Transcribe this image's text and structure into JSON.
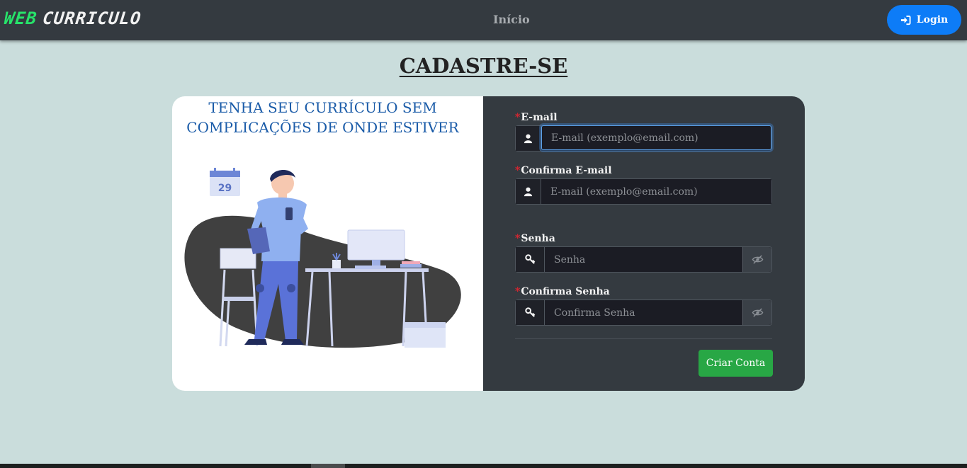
{
  "navbar": {
    "brand_part1": "WEB",
    "brand_part2": "CURRICULO",
    "home_link": "Início",
    "login_label": "Login",
    "login_icon": "sign-in-icon"
  },
  "page": {
    "title": "CADASTRE-SE"
  },
  "promo": {
    "tagline_line1": "TENHA SEU CURRÍCULO SEM",
    "tagline_line2": "COMPLICAÇÕES DE ONDE ESTIVER",
    "calendar_day": "29"
  },
  "form": {
    "email": {
      "required_mark": "*",
      "label": "E-mail",
      "placeholder": "E-mail (exemplo@email.com)",
      "value": "",
      "icon": "user-icon"
    },
    "confirm_email": {
      "required_mark": "*",
      "label": "Confirma E-mail",
      "placeholder": "E-mail (exemplo@email.com)",
      "value": "",
      "icon": "user-icon"
    },
    "password": {
      "required_mark": "*",
      "label": "Senha",
      "placeholder": "Senha",
      "value": "",
      "icon": "key-icon",
      "toggle_icon": "eye-slash-icon"
    },
    "confirm_password": {
      "required_mark": "*",
      "label": "Confirma Senha",
      "placeholder": "Confirma Senha",
      "value": "",
      "icon": "key-icon",
      "toggle_icon": "eye-slash-icon"
    },
    "submit_label": "Criar Conta"
  },
  "colors": {
    "background": "#cadddc",
    "navbar": "#343a40",
    "brand_accent": "#27e36a",
    "login_button": "#0d7cf7",
    "tagline": "#1a5ba8",
    "required": "#e0242f",
    "submit_button": "#28a745"
  }
}
